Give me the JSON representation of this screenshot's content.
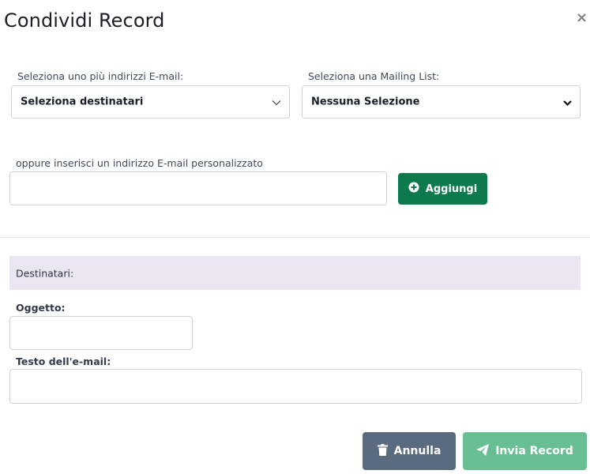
{
  "dialog": {
    "title": "Condividi Record",
    "close_label": "×"
  },
  "recipients_select": {
    "label": "Seleziona uno più indirizzi E-mail:",
    "value": "Seleziona destinatari"
  },
  "mailing_list": {
    "label": "Seleziona una Mailing List:",
    "value": "Nessuna Selezione"
  },
  "custom_email": {
    "label": "oppure inserisci un indirizzo E-mail personalizzato",
    "value": "",
    "add_button": "Aggiungi"
  },
  "recipients": {
    "label": "Destinatari:"
  },
  "subject": {
    "label": "Oggetto:",
    "value": ""
  },
  "body": {
    "label": "Testo dell'e-mail:",
    "value": ""
  },
  "footer": {
    "cancel_button": "Annulla",
    "send_button": "Invia Record"
  },
  "colors": {
    "add_button": "#0c7a4c",
    "cancel_button": "#5a6b7f",
    "send_button": "#69bf94",
    "recipients_bar": "#e9e6f1"
  },
  "icons": {
    "close": "close-icon",
    "add": "plus-circle-icon",
    "cancel": "trash-icon",
    "send": "paper-plane-icon",
    "dropdown": "chevron-down-icon"
  }
}
